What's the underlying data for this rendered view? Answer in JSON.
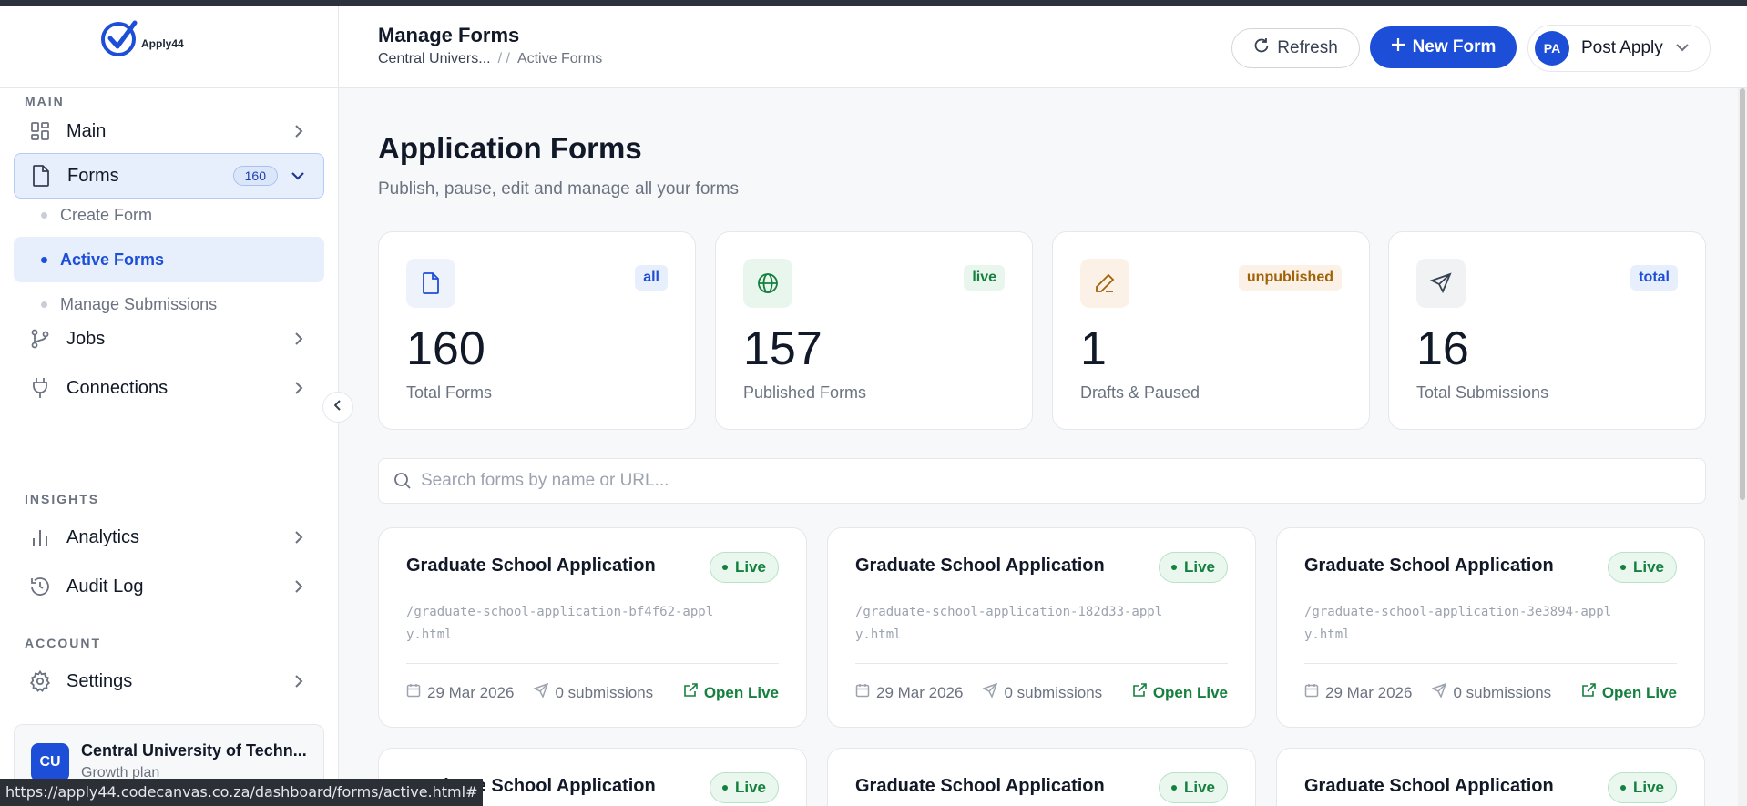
{
  "brand": {
    "logo_text": "Apply44",
    "accent": "#1d4ed8"
  },
  "sidebar": {
    "sections": {
      "main": "MAIN",
      "insights": "INSIGHTS",
      "account": "ACCOUNT"
    },
    "items": {
      "main": "Main",
      "forms": "Forms",
      "forms_count": "160",
      "jobs": "Jobs",
      "connections": "Connections",
      "analytics": "Analytics",
      "audit_log": "Audit Log",
      "settings": "Settings"
    },
    "subitems": {
      "create_form": "Create Form",
      "active_forms": "Active Forms",
      "manage_submissions": "Manage Submissions"
    },
    "org": {
      "initials": "CU",
      "name": "Central University of Techn...",
      "plan": "Growth plan"
    }
  },
  "header": {
    "title": "Manage Forms",
    "breadcrumb": [
      "Central Univers...",
      "/ /",
      "Active Forms"
    ],
    "refresh_label": "Refresh",
    "new_form_label": "New Form",
    "user": {
      "initials": "PA",
      "name": "Post Apply"
    }
  },
  "main": {
    "heading": "Application Forms",
    "subheading": "Publish, pause, edit and manage all your forms",
    "stats": [
      {
        "tag": "all",
        "value": "160",
        "label": "Total Forms",
        "icon": "document-icon",
        "tint": "#eef2fb",
        "tag_bg": "#e8effc",
        "tag_color": "#1d4ed8"
      },
      {
        "tag": "live",
        "value": "157",
        "label": "Published Forms",
        "icon": "globe-icon",
        "tint": "#e9f6ee",
        "tag_bg": "#e9f6ee",
        "tag_color": "#15803d"
      },
      {
        "tag": "unpublished",
        "value": "1",
        "label": "Drafts & Paused",
        "icon": "pencil-icon",
        "tint": "#fbf1e6",
        "tag_bg": "#fbf1e6",
        "tag_color": "#a16207"
      },
      {
        "tag": "total",
        "value": "16",
        "label": "Total Submissions",
        "icon": "send-icon",
        "tint": "#f1f2f4",
        "tag_bg": "#e8effc",
        "tag_color": "#1d4ed8"
      }
    ],
    "search_placeholder": "Search forms by name or URL...",
    "forms": [
      {
        "title": "Graduate School Application",
        "status": "Live",
        "slug": "/graduate-school-application-bf4f62-apply.html",
        "date": "29 Mar 2026",
        "submissions": "0 submissions",
        "open_label": "Open Live"
      },
      {
        "title": "Graduate School Application",
        "status": "Live",
        "slug": "/graduate-school-application-182d33-apply.html",
        "date": "29 Mar 2026",
        "submissions": "0 submissions",
        "open_label": "Open Live"
      },
      {
        "title": "Graduate School Application",
        "status": "Live",
        "slug": "/graduate-school-application-3e3894-apply.html",
        "date": "29 Mar 2026",
        "submissions": "0 submissions",
        "open_label": "Open Live"
      },
      {
        "title": "Graduate School Application",
        "status": "Live"
      },
      {
        "title": "Graduate School Application",
        "status": "Live"
      },
      {
        "title": "Graduate School Application",
        "status": "Live"
      }
    ]
  },
  "statusbar": {
    "url": "https://apply44.codecanvas.co.za/dashboard/forms/active.html#"
  }
}
